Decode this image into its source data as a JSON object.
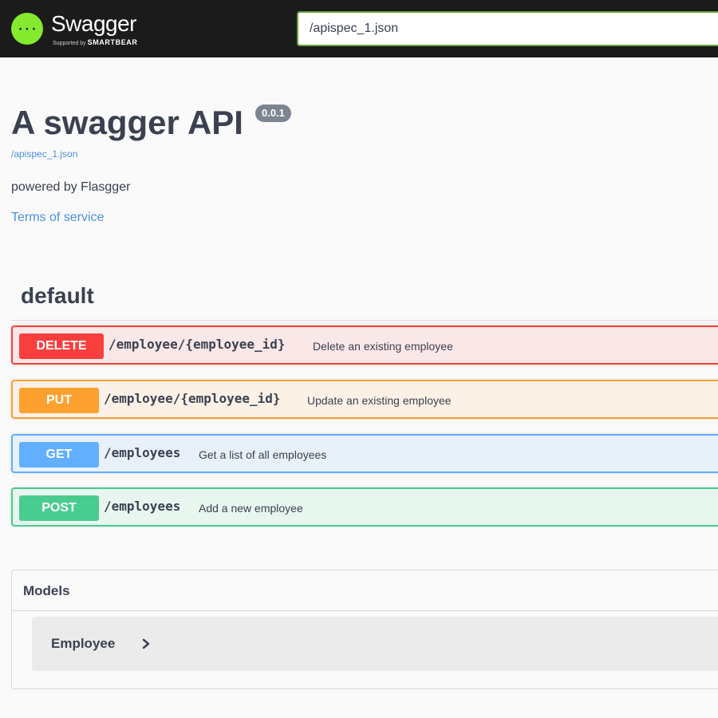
{
  "topbar": {
    "logo": {
      "name": "Swagger",
      "supported_by": "Supported by",
      "brand": "SMARTBEAR",
      "icon": "swagger-braces-icon",
      "accent": "#85ea2d"
    },
    "url_value": "/apispec_1.json",
    "input_border": "#62a03f"
  },
  "info": {
    "title": "A swagger API",
    "version": "0.0.1",
    "spec_link": "/apispec_1.json",
    "description": "powered by Flasgger",
    "terms_link": "Terms of service"
  },
  "section": {
    "title": "default",
    "operations": [
      {
        "method": "DELETE",
        "path": "/employee/{employee_id}",
        "summary": "Delete an existing employee",
        "color": "#f93e3e"
      },
      {
        "method": "PUT",
        "path": "/employee/{employee_id}",
        "summary": "Update an existing employee",
        "color": "#fca130"
      },
      {
        "method": "GET",
        "path": "/employees",
        "summary": "Get a list of all employees",
        "color": "#61affe"
      },
      {
        "method": "POST",
        "path": "/employees",
        "summary": "Add a new employee",
        "color": "#49cc90"
      }
    ]
  },
  "models": {
    "title": "Models",
    "items": [
      {
        "name": "Employee",
        "icon": "chevron-right-icon"
      }
    ]
  }
}
